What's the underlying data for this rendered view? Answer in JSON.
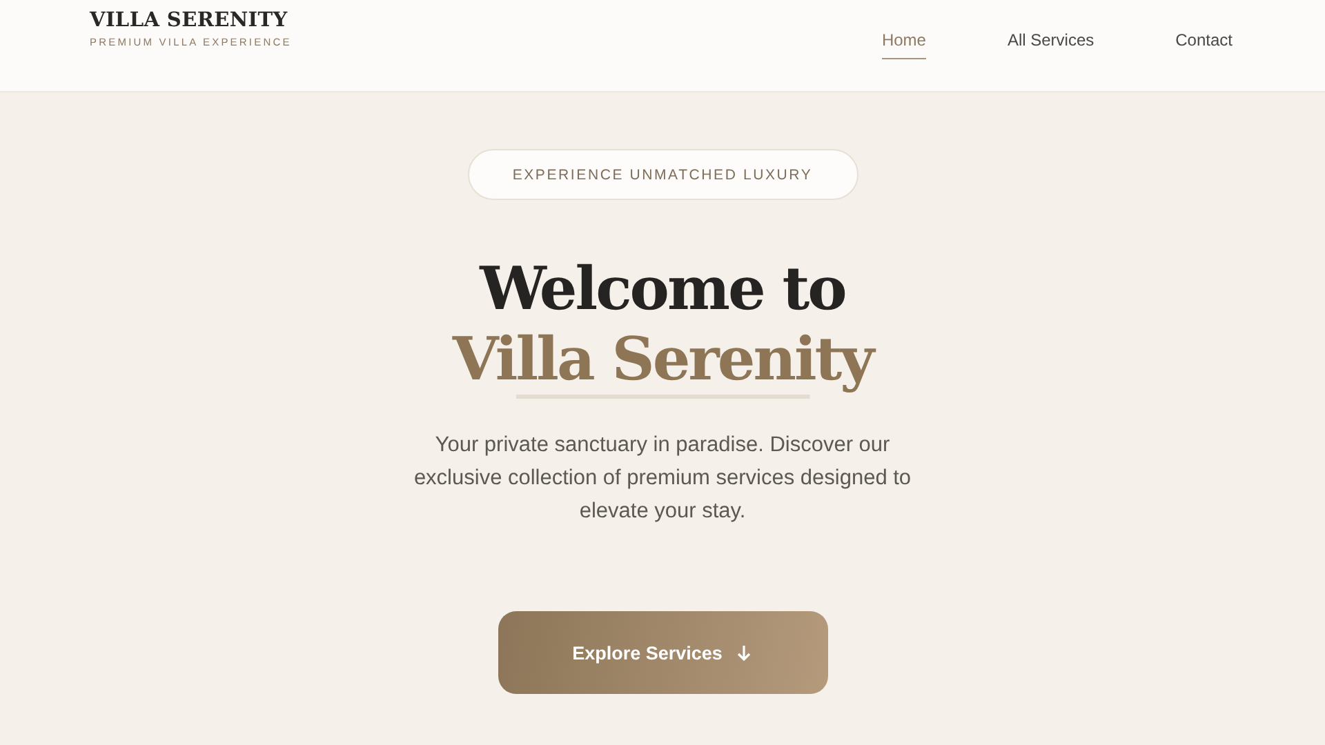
{
  "header": {
    "brand": "VILLA SERENITY",
    "tagline": "PREMIUM VILLA EXPERIENCE",
    "nav": [
      {
        "label": "Home",
        "selected": true
      },
      {
        "label": "All Services",
        "selected": false
      },
      {
        "label": "Contact",
        "selected": false
      }
    ]
  },
  "hero": {
    "badge": "EXPERIENCE UNMATCHED LUXURY",
    "title_line_1": "Welcome to",
    "title_line_2": "Villa Serenity",
    "description": "Your private sanctuary in paradise. Discover our exclusive collection of premium services designed to elevate your stay.",
    "button": "Explore Services"
  }
}
